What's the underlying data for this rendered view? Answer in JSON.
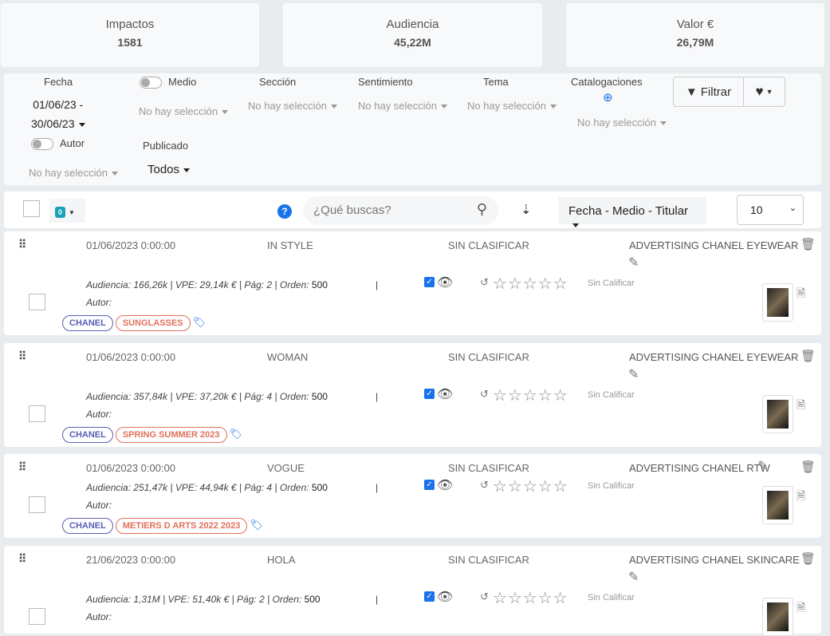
{
  "kpis": [
    {
      "label": "Impactos",
      "value": "1581"
    },
    {
      "label": "Audiencia",
      "value": "45,22M"
    },
    {
      "label": "Valor €",
      "value": "26,79M"
    }
  ],
  "filters": {
    "fecha_label": "Fecha",
    "fecha_from": "01/06/23 -",
    "fecha_to": "30/06/23",
    "medio": "Medio",
    "seccion": "Sección",
    "sentimiento": "Sentimiento",
    "tema": "Tema",
    "catalogaciones": "Catalogaciones",
    "autor": "Autor",
    "publicado": "Publicado",
    "publicado_value": "Todos",
    "none": "No hay selección",
    "filtrar": "Filtrar"
  },
  "toolbar": {
    "count": "0",
    "search_placeholder": "¿Qué buscas?",
    "sort": "Fecha - Medio - Titular",
    "page_size": "10"
  },
  "rating_label": "Sin Calificar",
  "items": [
    {
      "date": "01/06/2023 0:00:00",
      "media": "IN STYLE",
      "status": "SIN CLASIFICAR",
      "title": "ADVERTISING CHANEL EYEWEAR",
      "audiencia": "Audiencia: 166,26k",
      "vpe": "VPE: 29,14k €",
      "pag": "Pág: 2",
      "orden_label": "Orden:",
      "orden": "500",
      "autor": "Autor:",
      "tags": [
        "CHANEL",
        "SUNGLASSES"
      ]
    },
    {
      "date": "01/06/2023 0:00:00",
      "media": "WOMAN",
      "status": "SIN CLASIFICAR",
      "title": "ADVERTISING CHANEL EYEWEAR",
      "audiencia": "Audiencia: 357,84k",
      "vpe": "VPE: 37,20k €",
      "pag": "Pág: 4",
      "orden_label": "Orden:",
      "orden": "500",
      "autor": "Autor:",
      "tags": [
        "CHANEL",
        "SPRING SUMMER 2023"
      ]
    },
    {
      "date": "01/06/2023 0:00:00",
      "media": "VOGUE",
      "status": "SIN CLASIFICAR",
      "title": "ADVERTISING CHANEL RTW",
      "audiencia": "Audiencia: 251,47k",
      "vpe": "VPE: 44,94k €",
      "pag": "Pág: 4",
      "orden_label": "Orden:",
      "orden": "500",
      "autor": "Autor:",
      "tags": [
        "CHANEL",
        "METIERS D ARTS 2022 2023"
      ]
    },
    {
      "date": "21/06/2023 0:00:00",
      "media": "HOLA",
      "status": "SIN CLASIFICAR",
      "title": "ADVERTISING CHANEL SKINCARE",
      "audiencia": "Audiencia: 1,31M",
      "vpe": "VPE: 51,40k €",
      "pag": "Pág: 2",
      "orden_label": "Orden:",
      "orden": "500",
      "autor": "Autor:",
      "tags": []
    }
  ]
}
